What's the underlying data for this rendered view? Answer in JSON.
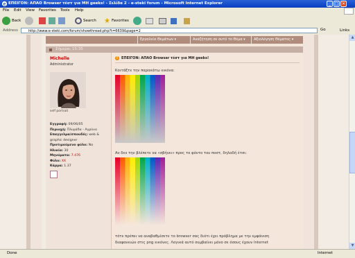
{
  "window": {
    "title": "ΕΠΕΙΓΟΝ: ΑΠΑΟ Browser τέστ για ΜΗ geeks! - Σελίδα 2 - e-steki forum - Microsoft Internet Explorer",
    "min": "_",
    "max": "□",
    "close": "✕"
  },
  "menu": [
    "File",
    "Edit",
    "View",
    "Favorites",
    "Tools",
    "Help"
  ],
  "toolbar": {
    "back": "Back",
    "search": "Search",
    "favorites": "Favorites"
  },
  "address": {
    "label": "Address",
    "url": "http://www.e-steki.com/forum/showthread.php?t=6639&page=2",
    "go": "Go",
    "links": "Links"
  },
  "forum_nav": [
    "Εργαλεία Θεμάτων ▾",
    "Αναζήτηση σε αυτό το Θέμα ▾",
    "Αξιολόγηση Θέματος ▾"
  ],
  "post": {
    "date": "Σήμερα, 15:35",
    "user": {
      "name": "Michelle",
      "title": "Administrator",
      "avatar_caption": "self portrait",
      "info": [
        {
          "k": "Εγγραφή:",
          "v": "09/06/05"
        },
        {
          "k": "Περιοχή:",
          "v": "Πλυμάδα - Αγρίνιο"
        },
        {
          "k": "Επαγγελμα/σπουδές:",
          "v": "web & graphic designer"
        },
        {
          "k": "Προτιμούμενο φύλο:",
          "v": "Να"
        },
        {
          "k": "Ηλικία:",
          "v": "30"
        },
        {
          "k": "Μηνύματα:",
          "v": "7.476"
        },
        {
          "k": "Φύλο:",
          "v": "XX"
        },
        {
          "k": "Κάρμα:",
          "v": "1.37"
        }
      ]
    },
    "title": "ΕΠΕΙΓΟΝ: ΑΠΑΟ Browser τέστ για ΜΗ geeks!",
    "lines": [
      "Κοιτάξτε την παρακάτω εικόνα:",
      "Αν δεν την βλέπετε να «σβήνει» προς το φόντο του ποστ, δηλαδή έτσι:",
      "τότε πρέπει να αναβαθμίσετε το browser σας διότι έχει πρόβλημα με την εμφάνιση",
      "διαφανειών στις png εικόνες. Λογικά αυτό συμβαίνει μόνο σε όσους έχουν Internet"
    ],
    "gradient_colors": [
      "#e60026",
      "#ff5a00",
      "#ffb400",
      "#ffee00",
      "#a6d800",
      "#00a64a",
      "#00b0c8",
      "#0058c8",
      "#5a28b4",
      "#a01e9a"
    ],
    "gradient_fade_1": "#c9c8c8",
    "gradient_fade_2": "#f5e6dc"
  },
  "status": {
    "done": "Done",
    "zone": "Internet"
  }
}
